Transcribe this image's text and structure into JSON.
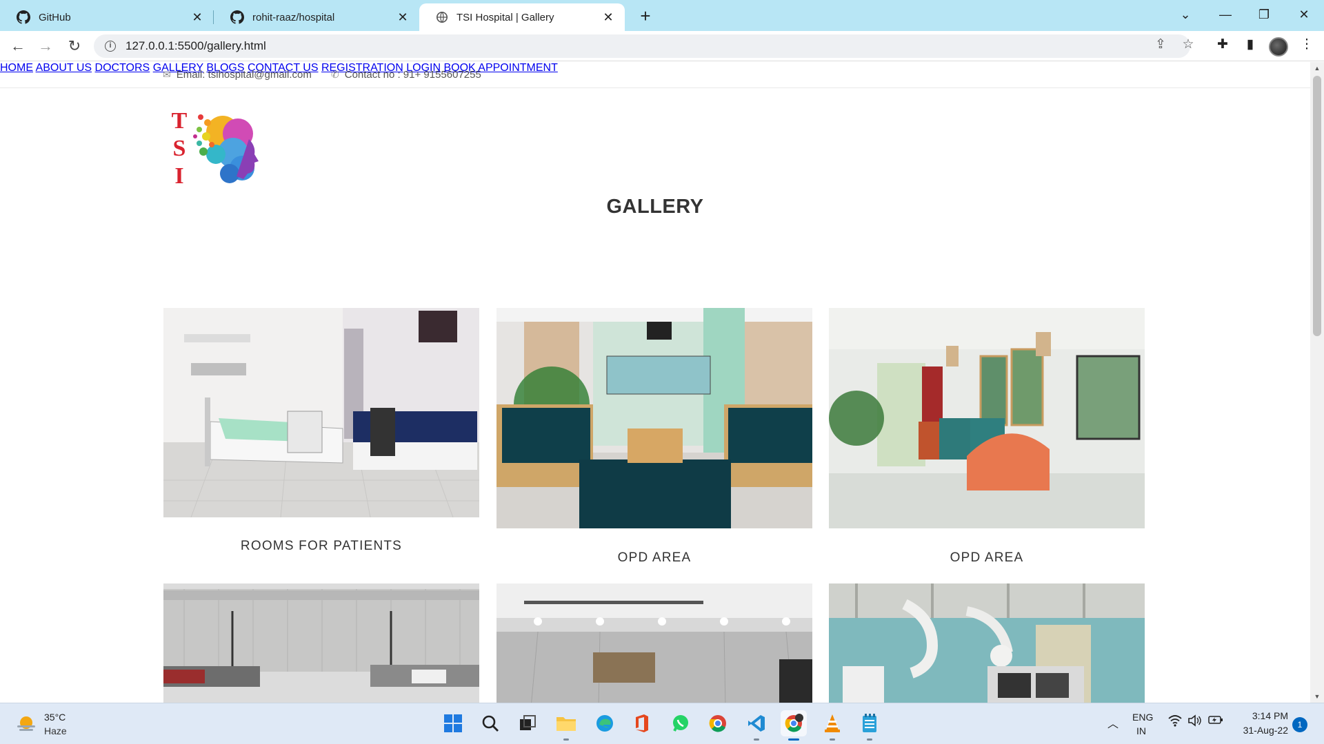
{
  "browser": {
    "tabs": [
      {
        "title": "GitHub",
        "icon": "github-icon",
        "active": false
      },
      {
        "title": "rohit-raaz/hospital",
        "icon": "github-icon",
        "active": false
      },
      {
        "title": "TSI Hospital | Gallery",
        "icon": "globe-icon",
        "active": true
      }
    ],
    "url": "127.0.0.1:5500/gallery.html"
  },
  "site": {
    "topbar": {
      "email": "Email: tsihospital@gmail.com",
      "contact": "Contact no : 91+ 9155607255"
    },
    "logo_letters": [
      "T",
      "S",
      "I"
    ],
    "nav": [
      "HOME",
      "ABOUT US",
      "DOCTORS",
      "GALLERY",
      "BLOGS",
      "CONTACT US",
      "REGISTRATION",
      "LOGIN",
      "BOOK APPOINTMENT"
    ],
    "page_title": "GALLERY",
    "gallery": [
      {
        "caption": "ROOMS FOR PATIENTS",
        "image": "patient-room-photo"
      },
      {
        "caption": "OPD AREA",
        "image": "opd-waiting-area-photo"
      },
      {
        "caption": "OPD AREA",
        "image": "opd-lounge-photo"
      },
      {
        "caption": "",
        "image": "parking-lot-photo"
      },
      {
        "caption": "",
        "image": "reception-lobby-photo"
      },
      {
        "caption": "",
        "image": "operating-theatre-photo"
      }
    ]
  },
  "taskbar": {
    "weather_temp": "35°C",
    "weather_desc": "Haze",
    "lang_line1": "ENG",
    "lang_line2": "IN",
    "time": "3:14 PM",
    "date": "31-Aug-22",
    "notification_count": "1"
  },
  "colors": {
    "tabbar": "#b8e6f5",
    "taskbar": "#dfe9f6",
    "accent": "#0067c0"
  }
}
